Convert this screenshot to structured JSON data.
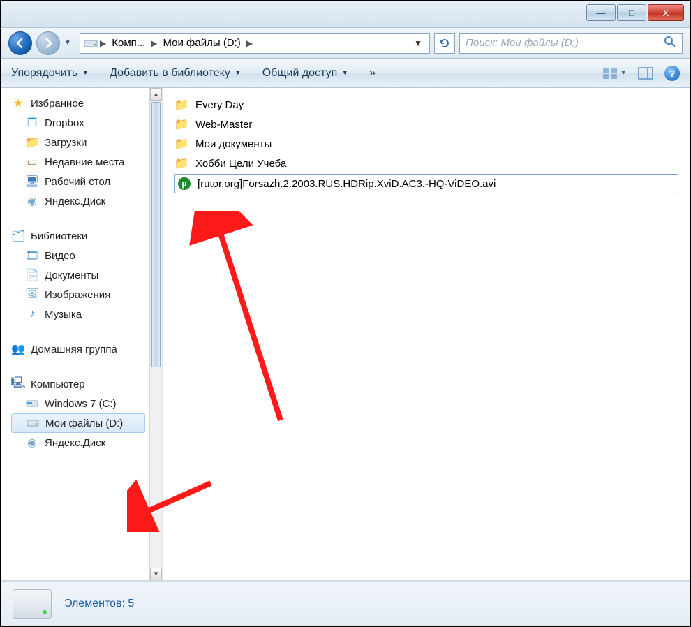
{
  "window": {
    "min": "—",
    "max": "□",
    "close": "X"
  },
  "nav": {
    "breadcrumb": {
      "seg1": "Комп...",
      "seg2": "Мои файлы (D:)"
    },
    "search_placeholder": "Поиск: Мои файлы (D:)"
  },
  "toolbar": {
    "organize": "Упорядочить",
    "add_library": "Добавить в библиотеку",
    "share": "Общий доступ",
    "overflow": "»"
  },
  "sidebar": {
    "favorites": {
      "head": "Избранное",
      "items": [
        "Dropbox",
        "Загрузки",
        "Недавние места",
        "Рабочий стол",
        "Яндекс.Диск"
      ]
    },
    "libraries": {
      "head": "Библиотеки",
      "items": [
        "Видео",
        "Документы",
        "Изображения",
        "Музыка"
      ]
    },
    "homegroup": {
      "head": "Домашняя группа"
    },
    "computer": {
      "head": "Компьютер",
      "items": [
        "Windows 7 (C:)",
        "Мои файлы (D:)",
        "Яндекс.Диск"
      ]
    }
  },
  "files": {
    "folders": [
      "Every Day",
      "Web-Master",
      "Мои документы",
      "Хобби Цели Учеба"
    ],
    "selected_file": "[rutor.org]Forsazh.2.2003.RUS.HDRip.XviD.AC3.-HQ-ViDEO.avi"
  },
  "status": {
    "text": "Элементов: 5"
  }
}
